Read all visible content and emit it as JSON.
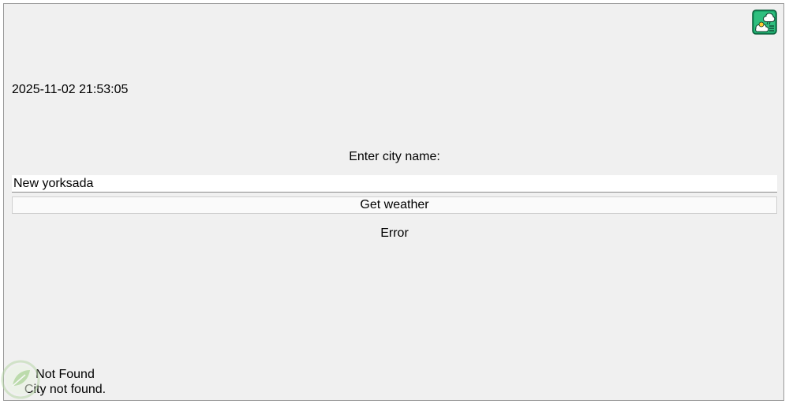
{
  "datetime": "2025-11-02 21:53:05",
  "form": {
    "prompt": "Enter city name:",
    "city_value": "New yorksada",
    "button_label": "Get weather"
  },
  "result": {
    "status": "Error"
  },
  "bottom": {
    "title": "Not Found",
    "message": "City not found."
  },
  "icons": {
    "app_icon": "weather-app-icon",
    "watermark": "leaf-watermark-icon"
  },
  "colors": {
    "window_bg": "#f0f0f0",
    "icon_accent": "#1aa86a"
  }
}
